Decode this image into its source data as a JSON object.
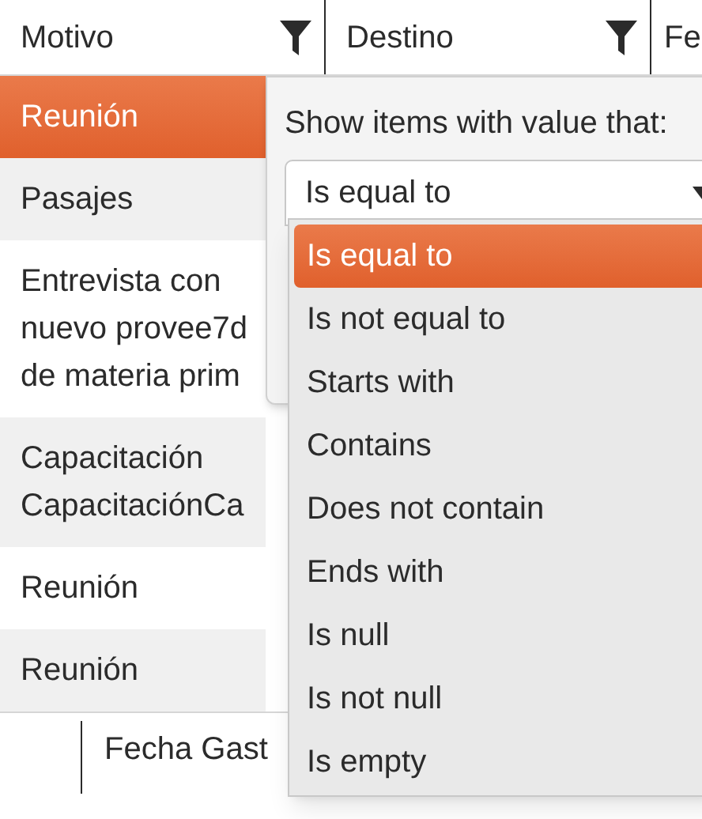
{
  "columns": [
    {
      "label": "Motivo",
      "filter": true
    },
    {
      "label": "Destino",
      "filter": true
    },
    {
      "label": "Fe",
      "filter": false
    }
  ],
  "rows": [
    {
      "motivo": "Reunión",
      "selected": true
    },
    {
      "motivo": "Pasajes",
      "selected": false
    },
    {
      "motivo": "Entrevista con\nnuevo provee7d\nde materia prim",
      "selected": false
    },
    {
      "motivo": "Capacitación\nCapacitaciónCa",
      "selected": false
    },
    {
      "motivo": "Reunión",
      "selected": false
    },
    {
      "motivo": "Reunión",
      "selected": false
    }
  ],
  "footer": {
    "column_2": "Fecha Gast"
  },
  "filter_popup": {
    "prompt": "Show items with value that:",
    "operator": {
      "value": "Is equal to",
      "expanded": true
    },
    "options": [
      {
        "label": "Is equal to",
        "selected": true
      },
      {
        "label": "Is not equal to",
        "selected": false
      },
      {
        "label": "Starts with",
        "selected": false
      },
      {
        "label": "Contains",
        "selected": false
      },
      {
        "label": "Does not contain",
        "selected": false
      },
      {
        "label": "Ends with",
        "selected": false
      },
      {
        "label": "Is null",
        "selected": false
      },
      {
        "label": "Is not null",
        "selected": false
      },
      {
        "label": "Is empty",
        "selected": false
      }
    ]
  }
}
